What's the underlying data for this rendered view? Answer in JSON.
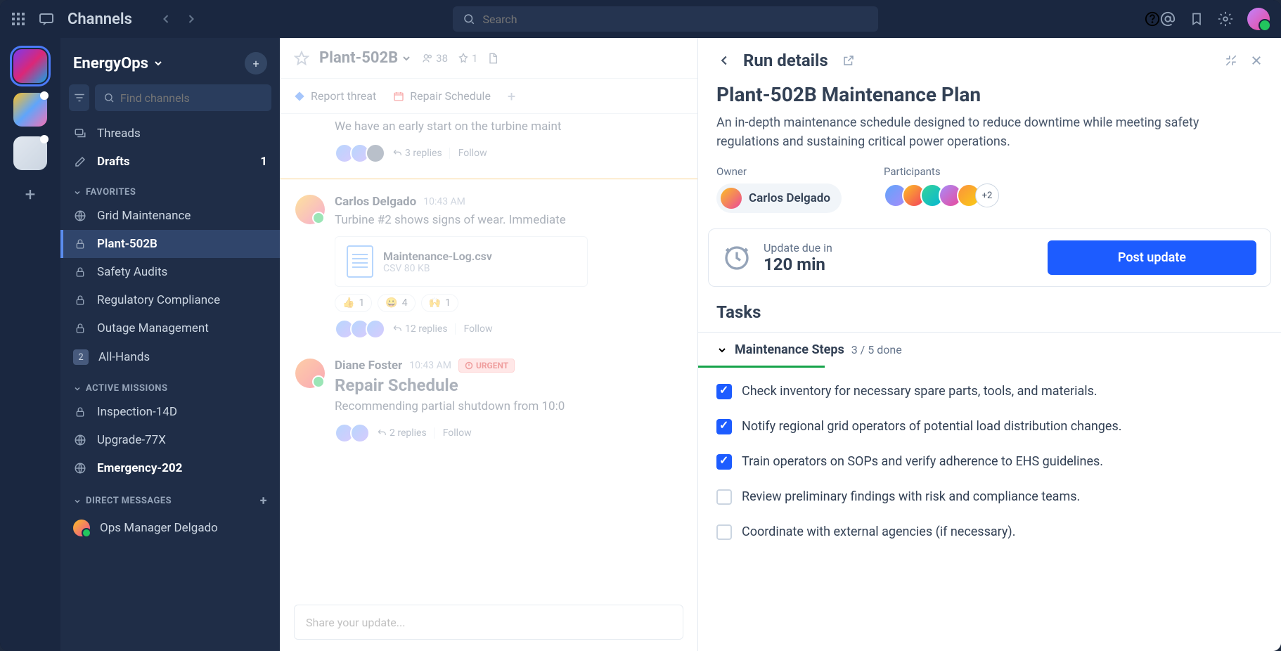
{
  "topbar": {
    "channels_label": "Channels",
    "search_placeholder": "Search"
  },
  "team": {
    "name": "EnergyOps",
    "find_placeholder": "Find channels"
  },
  "nav": {
    "threads": "Threads",
    "drafts": "Drafts",
    "drafts_count": "1"
  },
  "sections": {
    "favorites": "FAVORITES",
    "active_missions": "ACTIVE MISSIONS",
    "direct_messages": "DIRECT MESSAGES"
  },
  "favorites": [
    {
      "name": "Grid Maintenance",
      "icon": "globe",
      "active": false
    },
    {
      "name": "Plant-502B",
      "icon": "lock",
      "active": true
    },
    {
      "name": "Safety Audits",
      "icon": "lock",
      "active": false
    },
    {
      "name": "Regulatory Compliance",
      "icon": "lock",
      "active": false
    },
    {
      "name": "Outage Management",
      "icon": "lock",
      "active": false
    },
    {
      "name": "All-Hands",
      "icon": "count",
      "count": "2",
      "active": false
    }
  ],
  "missions": [
    {
      "name": "Inspection-14D",
      "icon": "lock",
      "bold": false
    },
    {
      "name": "Upgrade-77X",
      "icon": "globe",
      "bold": false
    },
    {
      "name": "Emergency-202",
      "icon": "globe",
      "bold": true
    }
  ],
  "dms": [
    {
      "name": "Ops Manager Delgado"
    }
  ],
  "channel": {
    "name": "Plant-502B",
    "members": "38",
    "pinned": "1",
    "tabs": [
      {
        "label": "Report threat",
        "icon": "diamond"
      },
      {
        "label": "Repair Schedule",
        "icon": "calendar"
      }
    ]
  },
  "messages": [
    {
      "author": "",
      "text": "We have an early start on the turbine maint",
      "replies": "3 replies",
      "follow": "Follow",
      "avatars": 3
    },
    {
      "author": "Carlos Delgado",
      "time": "10:43 AM",
      "text": "Turbine #2 shows signs of wear. Immediate",
      "attachment": {
        "name": "Maintenance-Log.csv",
        "meta": "CSV 80 KB"
      },
      "reactions": [
        {
          "emoji": "👍",
          "count": "1"
        },
        {
          "emoji": "😀",
          "count": "4"
        },
        {
          "emoji": "🙌",
          "count": "1"
        }
      ],
      "replies": "12 replies",
      "follow": "Follow",
      "avatars": 3
    },
    {
      "author": "Diane Foster",
      "time": "10:43 AM",
      "urgent": "URGENT",
      "title": "Repair Schedule",
      "text": "Recommending partial shutdown from 10:0",
      "replies": "2 replies",
      "follow": "Follow",
      "avatars": 2
    }
  ],
  "compose_placeholder": "Share your update...",
  "panel": {
    "header": "Run details",
    "title": "Plant-502B Maintenance Plan",
    "description": "An in-depth maintenance schedule designed to reduce downtime while meeting safety regulations and sustaining critical power operations.",
    "owner_label": "Owner",
    "owner_name": "Carlos Delgado",
    "participants_label": "Participants",
    "participants_more": "+2",
    "due_label": "Update due in",
    "due_time": "120 min",
    "post_button": "Post update",
    "tasks_title": "Tasks",
    "section_title": "Maintenance Steps",
    "section_progress": "3 / 5 done",
    "tasks": [
      {
        "done": true,
        "text": "Check inventory for necessary spare parts, tools, and materials."
      },
      {
        "done": true,
        "text": "Notify regional grid operators of potential load distribution changes."
      },
      {
        "done": true,
        "text": "Train operators on SOPs and verify adherence to EHS guidelines."
      },
      {
        "done": false,
        "text": "Review preliminary findings with risk and compliance teams."
      },
      {
        "done": false,
        "text": "Coordinate with external agencies (if necessary)."
      }
    ]
  }
}
